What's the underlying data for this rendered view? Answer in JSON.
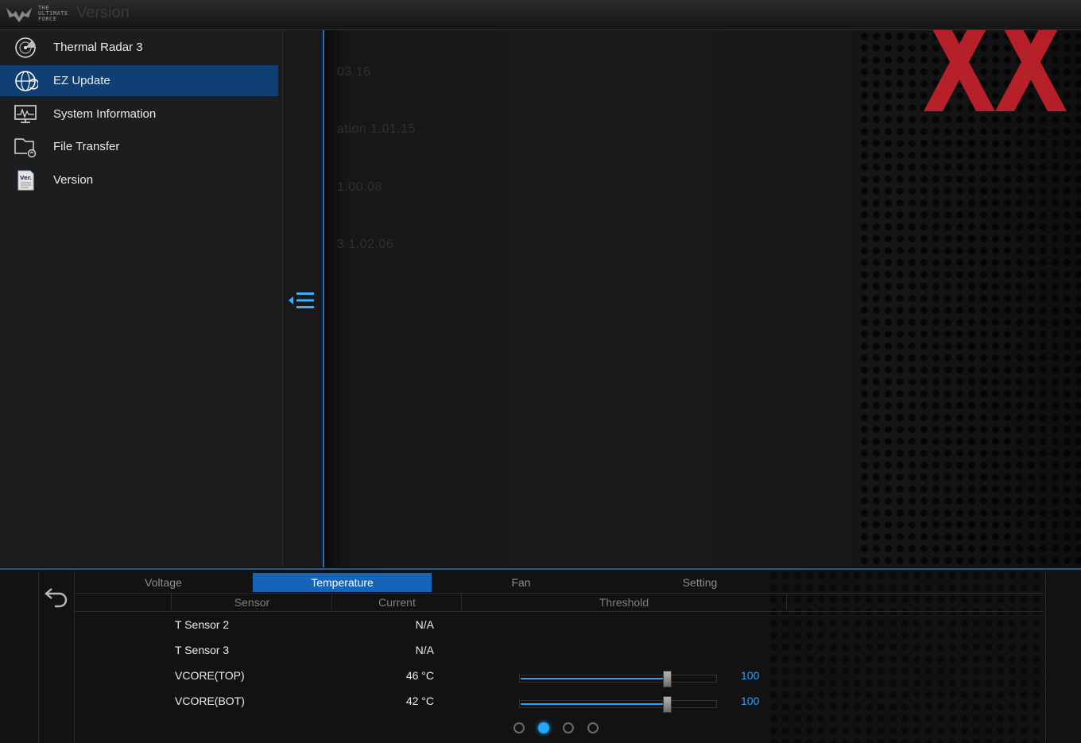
{
  "app": {
    "logo_text": "THE ULTIMATE FORCE",
    "window_title": "Version"
  },
  "sidebar": {
    "items": [
      {
        "label": "Thermal Radar 3",
        "icon": "thermal-radar-icon",
        "active": false
      },
      {
        "label": "EZ Update",
        "icon": "globe-update-icon",
        "active": true
      },
      {
        "label": "System Information",
        "icon": "monitor-chart-icon",
        "active": false
      },
      {
        "label": "File Transfer",
        "icon": "file-transfer-icon",
        "active": false
      },
      {
        "label": "Version",
        "icon": "version-document-icon",
        "active": false
      }
    ]
  },
  "main": {
    "ghost_lines": [
      "03.16",
      "ation   1.01.15",
      "1.00.08",
      "3    1.02.06"
    ],
    "watermark_color": "#c4222b"
  },
  "bottom": {
    "tabs": [
      {
        "label": "Voltage",
        "active": false
      },
      {
        "label": "Temperature",
        "active": true
      },
      {
        "label": "Fan",
        "active": false
      },
      {
        "label": "Setting",
        "active": false
      }
    ],
    "columns": [
      "Sensor",
      "Current",
      "Threshold"
    ],
    "rows": [
      {
        "sensor": "T Sensor 2",
        "current": "N/A",
        "threshold": null
      },
      {
        "sensor": "T Sensor 3",
        "current": "N/A",
        "threshold": null
      },
      {
        "sensor": "VCORE(TOP)",
        "current": "46 °C",
        "threshold": "100",
        "slider_fraction": 0.75
      },
      {
        "sensor": "VCORE(BOT)",
        "current": "42 °C",
        "threshold": "100",
        "slider_fraction": 0.75
      }
    ],
    "pages": 4,
    "active_page": 2
  },
  "colors": {
    "accent": "#1664b5",
    "highlight": "#2aa3ff",
    "sidebar_active": "#103f73"
  }
}
